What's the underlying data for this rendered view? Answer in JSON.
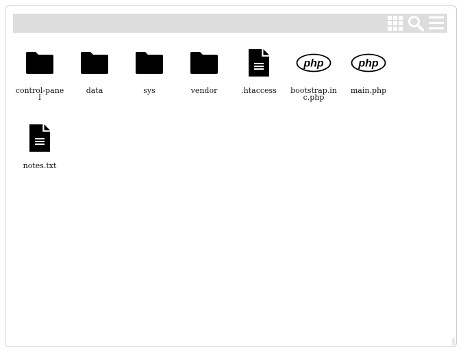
{
  "toolbar": {
    "icons": [
      "grid-view-icon",
      "search-icon",
      "menu-icon"
    ],
    "background": "#dddddd",
    "icon_color": "#ffffff"
  },
  "files": [
    {
      "name": "control-panel",
      "type": "folder"
    },
    {
      "name": "data",
      "type": "folder"
    },
    {
      "name": "sys",
      "type": "folder"
    },
    {
      "name": "vendor",
      "type": "folder"
    },
    {
      "name": ".htaccess",
      "type": "file"
    },
    {
      "name": "bootstrap.inc.php",
      "type": "php"
    },
    {
      "name": "main.php",
      "type": "php"
    },
    {
      "name": "notes.txt",
      "type": "file"
    }
  ]
}
